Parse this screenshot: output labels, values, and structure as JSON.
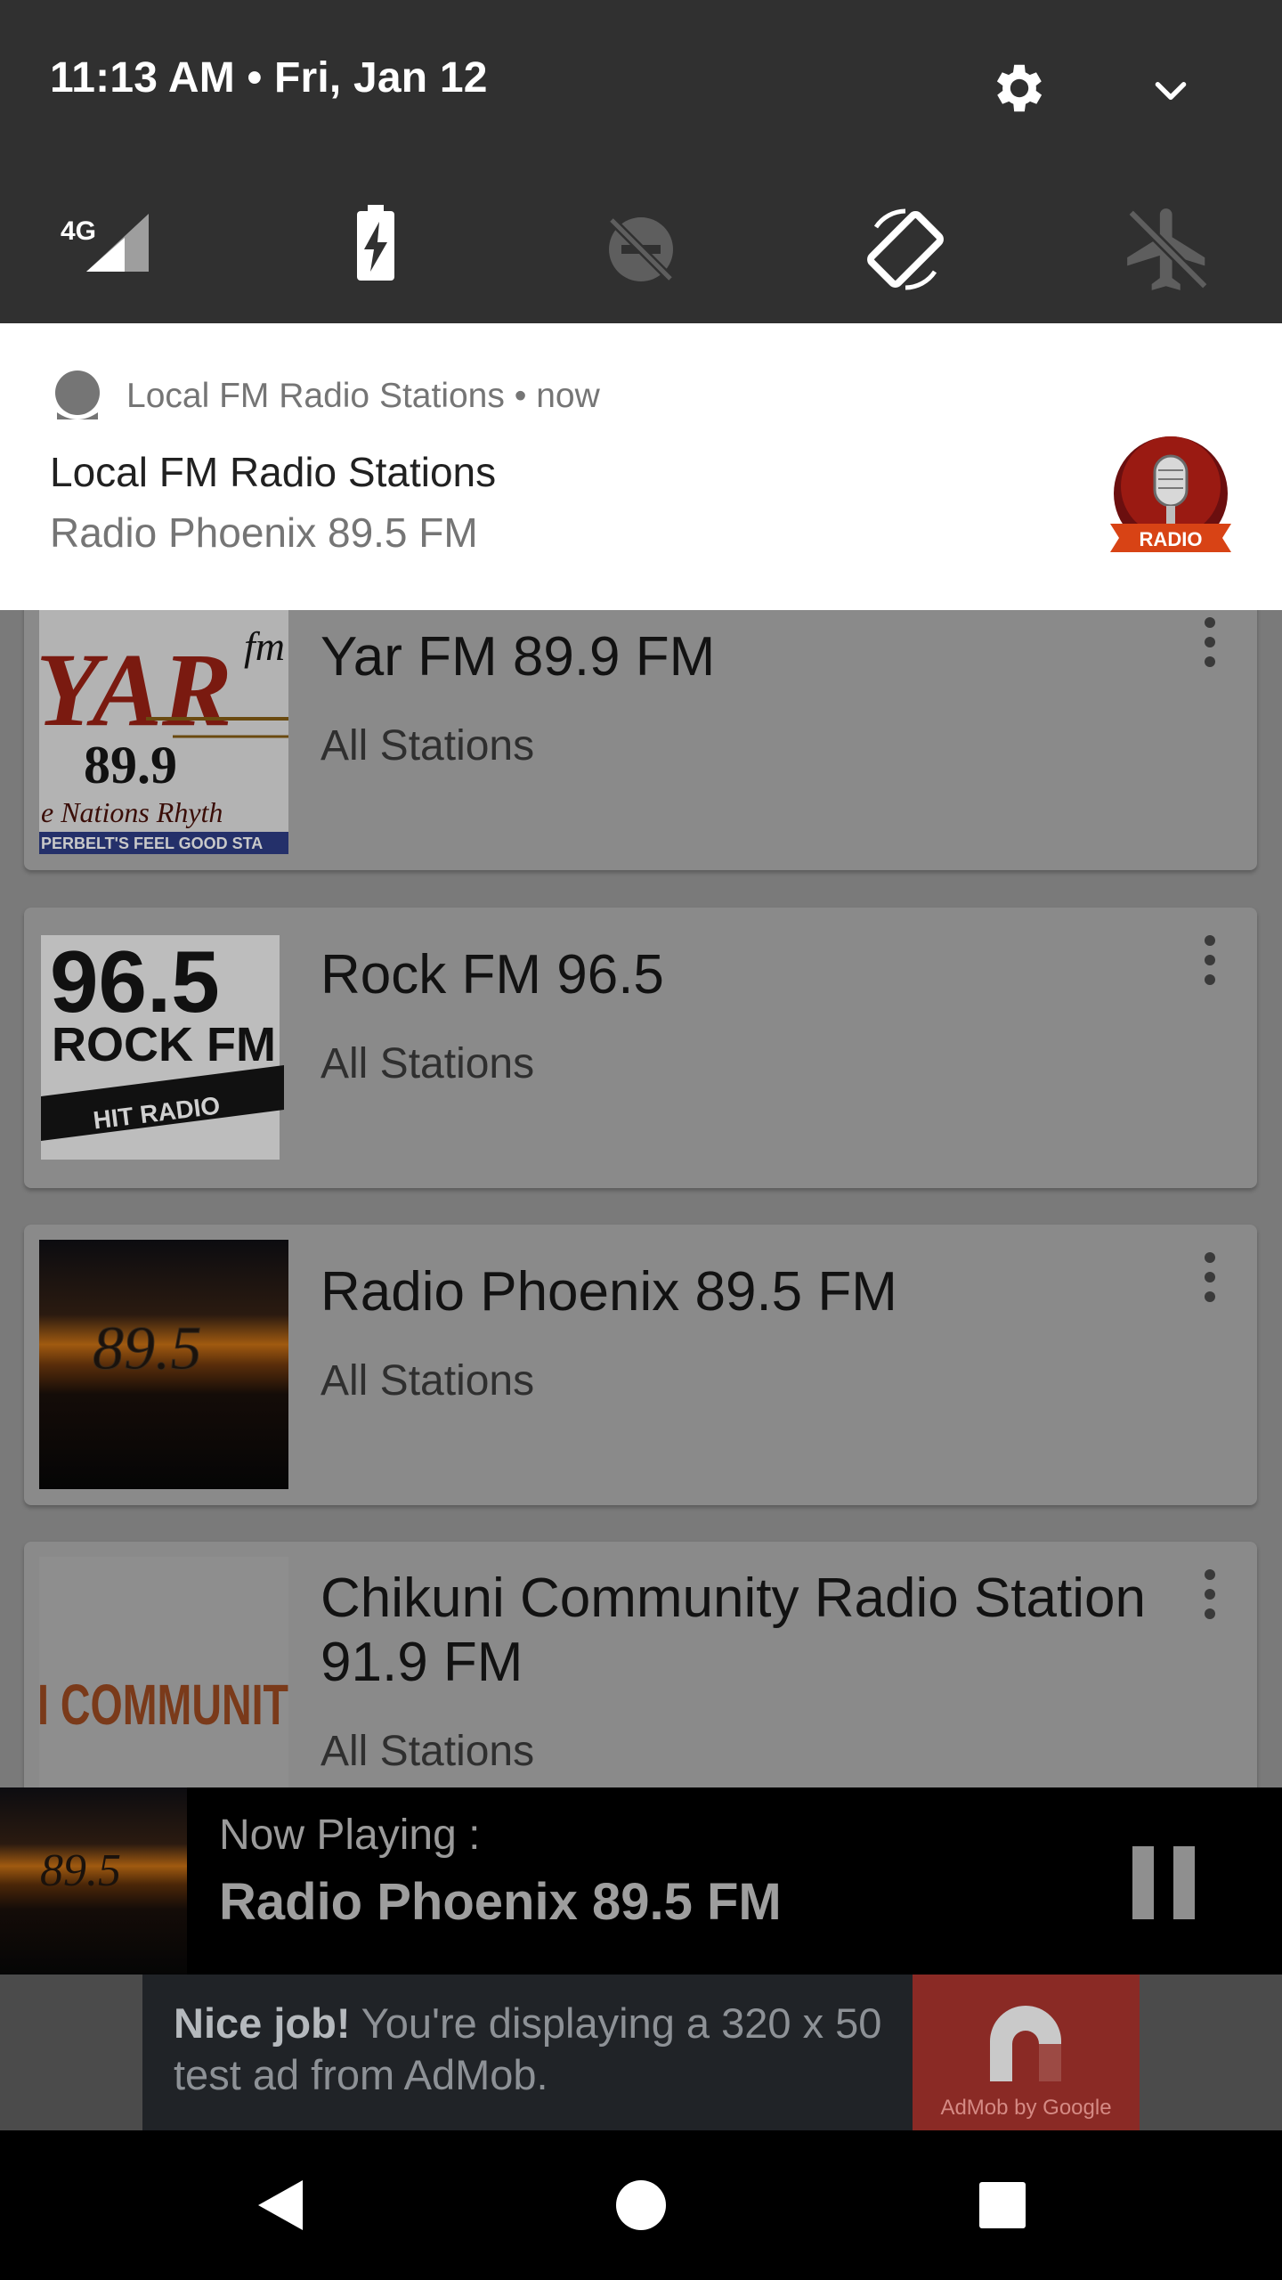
{
  "shade": {
    "datetime": "11:13 AM • Fri, Jan 12",
    "network_label": "4G",
    "icons": [
      "gear-icon",
      "chevron-down-icon",
      "signal-icon",
      "battery-charging-icon",
      "do-not-disturb-off-icon",
      "auto-rotate-icon",
      "airplane-mode-icon"
    ]
  },
  "notification": {
    "app_name": "Local FM Radio Stations",
    "time": "now",
    "title": "Local FM Radio Stations",
    "text": "Radio Phoenix 89.5 FM",
    "badge_label": "RADIO"
  },
  "stations": [
    {
      "name": "Yar FM 89.9 FM",
      "category": "All Stations",
      "logo": {
        "line1": "YAR",
        "fm": "fm",
        "freq": "89.9",
        "tagline": "e Nations Rhyth",
        "footer": "PERBELT'S FEEL GOOD STA"
      }
    },
    {
      "name": "Rock FM 96.5",
      "category": "All Stations",
      "logo": {
        "freq": "96.5",
        "line2": "ROCK FM",
        "banner": "HIT RADIO"
      }
    },
    {
      "name": "Radio Phoenix 89.5 FM",
      "category": "All Stations",
      "logo": {
        "overlay": "89.5"
      }
    },
    {
      "name": "Chikuni Community Radio Station 91.9 FM",
      "category": "All Stations",
      "logo": {
        "text": "I COMMUNIT"
      }
    }
  ],
  "player": {
    "label": "Now Playing :",
    "title": "Radio Phoenix 89.5 FM"
  },
  "ad": {
    "bold": "Nice job!",
    "text": " You're displaying a 320 x 50 test ad from AdMob.",
    "brand": "AdMob by Google"
  },
  "colors": {
    "shade_bg": "#303030",
    "card_bg": "#8a8a8a",
    "list_bg": "#7a7a7a",
    "ad_brand": "#8a2a25"
  }
}
